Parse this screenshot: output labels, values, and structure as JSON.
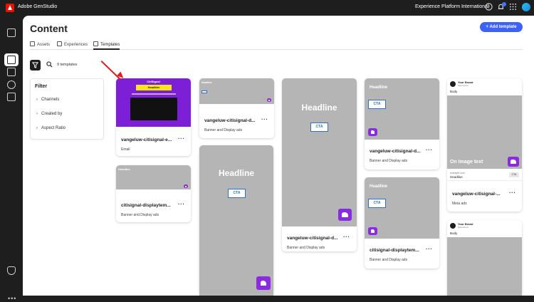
{
  "app": {
    "title": "Adobe GenStudio",
    "org": "Experience Platform International"
  },
  "page": {
    "title": "Content",
    "add_button": "Add template"
  },
  "tabs": [
    {
      "label": "Assets",
      "icon": "assets-icon"
    },
    {
      "label": "Experiences",
      "icon": "experiences-icon"
    },
    {
      "label": "Templates",
      "icon": "templates-icon",
      "active": true
    }
  ],
  "toolbar": {
    "count": "9 templates"
  },
  "filter": {
    "title": "Filter",
    "items": [
      "Channels",
      "Created by",
      "Aspect Ratio"
    ]
  },
  "cards": [
    {
      "name": "vangeluw-citisignal-e...",
      "type": "Email"
    },
    {
      "name": "citisignal-displaytem...",
      "type": "Banner and Display ads"
    },
    {
      "name": "vangeluw-citisignal-d...",
      "type": "Banner and Display ads"
    },
    {
      "name": "vangeluw-citisignal-d...",
      "type": "Banner and Display ads"
    },
    {
      "name": "vangeluw-citisignal-d...",
      "type": "Banner and Display ads"
    },
    {
      "name": "citisignal-displaytem...",
      "type": "Banner and Display ads"
    },
    {
      "name": "vangeluw-citisignal-...",
      "type": "Meta ads"
    }
  ],
  "thumb_text": {
    "headline": "Headline",
    "cta": "CTA",
    "email_brand": "CitiSignal",
    "email_headline": "Headline",
    "brand": "Your Brand",
    "sponsored": "Sponsored",
    "body": "Body",
    "on_image": "On Image text",
    "meta_url": "example.com",
    "meta_headline": "Headline",
    "meta_cta": "CTA"
  },
  "colors": {
    "accent": "#3b63fb",
    "email_purple": "#7d1fd6",
    "email_yellow": "#f7e51d",
    "cta_blue": "#2d70c9",
    "arrow": "#e02020"
  }
}
